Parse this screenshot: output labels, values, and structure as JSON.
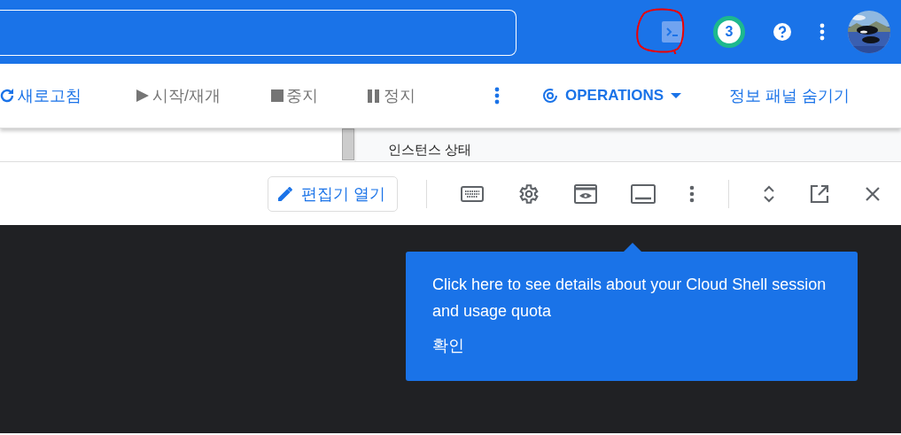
{
  "header": {
    "notification_count": "3"
  },
  "toolbar": {
    "actions": [
      {
        "kind": "refresh",
        "label": "새로고침",
        "disabled": false
      },
      {
        "kind": "play",
        "label": "시작/재개",
        "disabled": true
      },
      {
        "kind": "stop",
        "label": "중지",
        "disabled": true
      },
      {
        "kind": "pause",
        "label": "정지",
        "disabled": true
      }
    ],
    "operations": "OPERATIONS",
    "info_panel": "정보 패널 숨기기"
  },
  "info_panel": {
    "title": "인스턴스 상태"
  },
  "shell": {
    "open_editor": "편집기 열기"
  },
  "tooltip": {
    "text": "Click here to see details about your Cloud Shell session and usage quota",
    "button": "확인"
  }
}
